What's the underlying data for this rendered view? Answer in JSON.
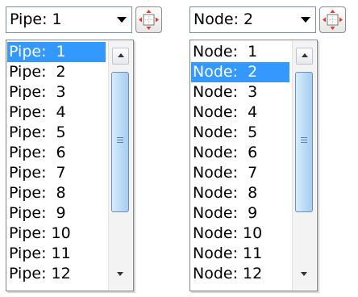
{
  "pipe_selector": {
    "selected": "Pipe:  1",
    "items": [
      "Pipe:  1",
      "Pipe:  2",
      "Pipe:  3",
      "Pipe:  4",
      "Pipe:  5",
      "Pipe:  6",
      "Pipe:  7",
      "Pipe:  8",
      "Pipe:  9",
      "Pipe: 10",
      "Pipe: 11",
      "Pipe: 12"
    ],
    "highlighted_index": 0
  },
  "node_selector": {
    "selected": "Node:  2",
    "items": [
      "Node:  1",
      "Node:  2",
      "Node:  3",
      "Node:  4",
      "Node:  5",
      "Node:  6",
      "Node:  7",
      "Node:  8",
      "Node:  9",
      "Node: 10",
      "Node: 11",
      "Node: 12"
    ],
    "highlighted_index": 1
  },
  "icons": {
    "zoom_button": "zoom-to-fit-icon",
    "scroll_up": "arrow-up-icon",
    "scroll_down": "arrow-down-icon",
    "scroll_grip": "grip-icon"
  },
  "colors": {
    "selection": "#3399ff",
    "selection_text": "#ffffff",
    "zoom_arrows": "#e23a2a"
  }
}
